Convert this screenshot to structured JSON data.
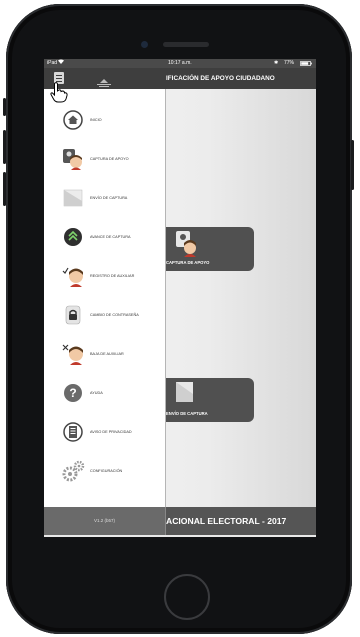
{
  "status_bar": {
    "device": "iPad",
    "time": "10:17 a.m.",
    "battery": "77%"
  },
  "nav": {
    "title": "IFICACIÓN DE APOYO CIUDADANO",
    "menu_icon": "hamburger-menu-icon",
    "logo_icon": "ine-logo-icon"
  },
  "drawer": {
    "items": [
      {
        "label": "INICIO",
        "icon": "home-icon"
      },
      {
        "label": "CAPTURA DE APOYO",
        "icon": "capture-support-icon"
      },
      {
        "label": "ENVÍO DE CAPTURA",
        "icon": "send-capture-icon"
      },
      {
        "label": "AVANCE DE CAPTURA",
        "icon": "progress-icon"
      },
      {
        "label": "REGISTRO DE AUXILIAR",
        "icon": "register-assistant-icon"
      },
      {
        "label": "CAMBIO DE CONTRASEÑA",
        "icon": "lock-icon"
      },
      {
        "label": "BAJA DE AUXILIAR",
        "icon": "remove-assistant-icon"
      },
      {
        "label": "AYUDA",
        "icon": "help-icon"
      },
      {
        "label": "AVISO DE PRIVACIDAD",
        "icon": "privacy-notice-icon"
      },
      {
        "label": "CONFIGURACIÓN",
        "icon": "gears-icon"
      }
    ],
    "version": "V1.2 (b57)"
  },
  "tiles": [
    {
      "label": "CAPTURA DE APOYO",
      "icon": "capture-support-icon"
    },
    {
      "label": "ENVÍO DE CAPTURA",
      "icon": "send-capture-icon"
    }
  ],
  "footer": {
    "title": "ACIONAL ELECTORAL - 2017"
  },
  "colors": {
    "navbar": "#3e3e3e",
    "footer": "#555555",
    "tile": "#505050",
    "drawer": "#ffffff"
  }
}
